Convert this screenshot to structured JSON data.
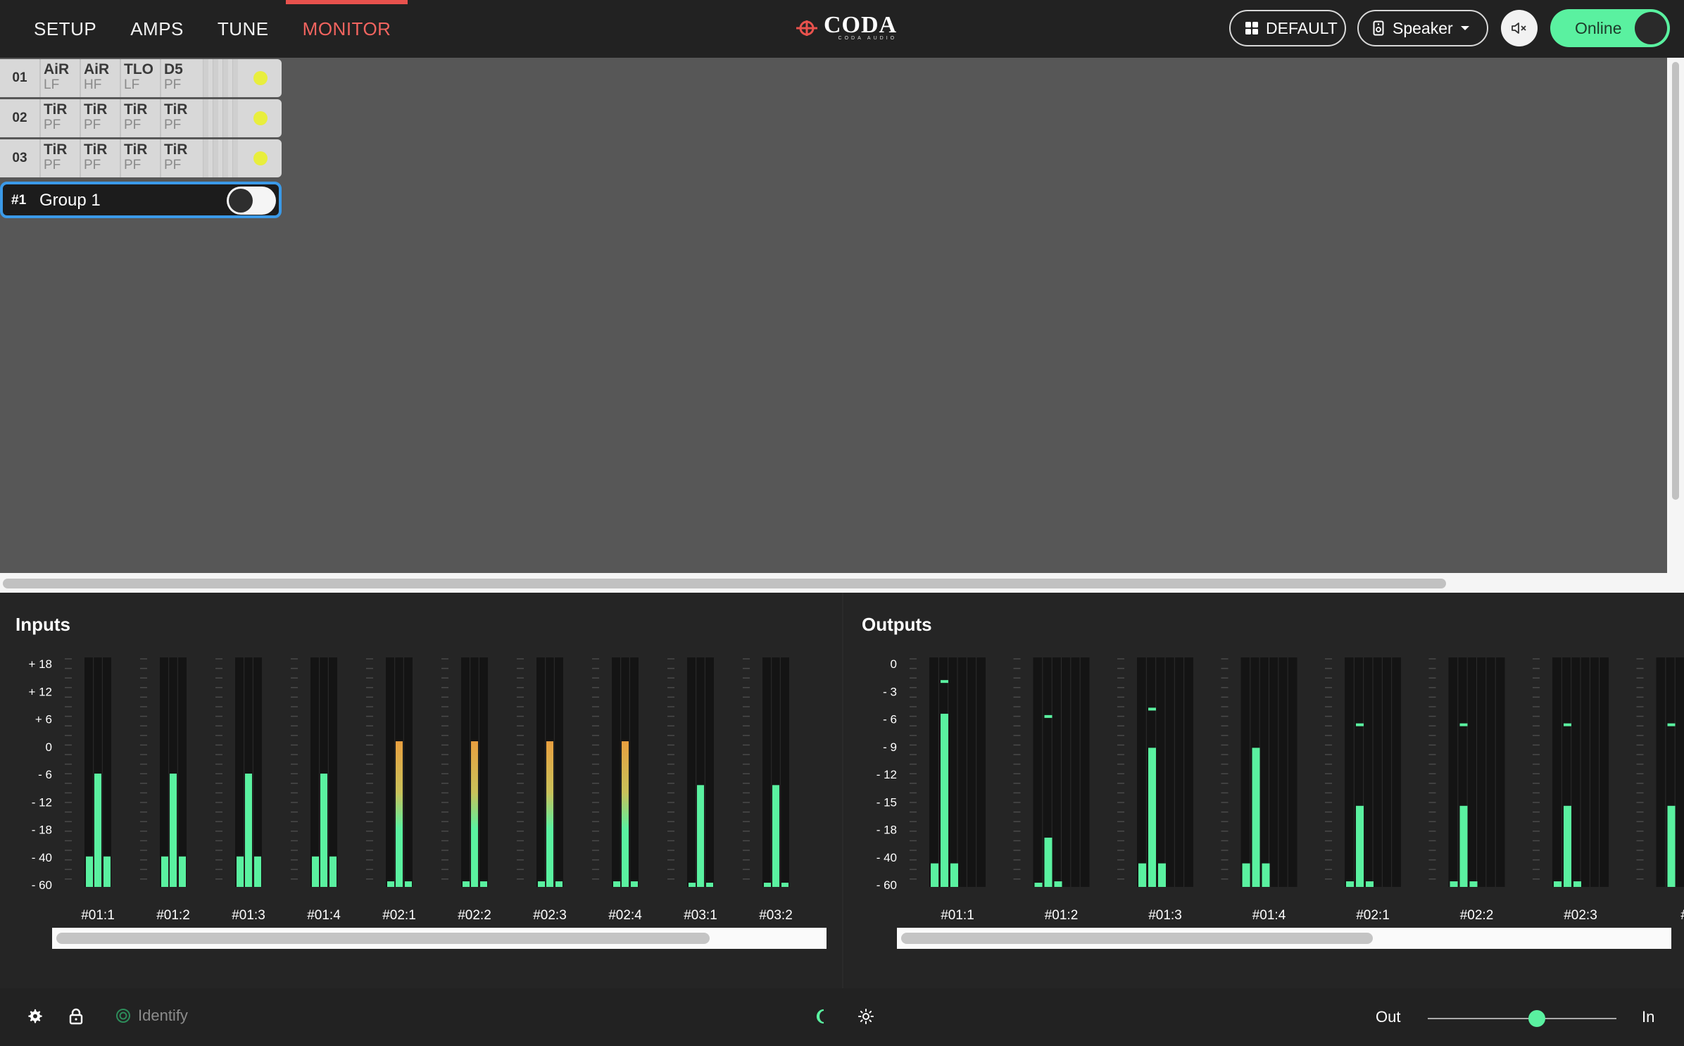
{
  "nav": {
    "tabs": [
      {
        "label": "SETUP"
      },
      {
        "label": "AMPS"
      },
      {
        "label": "TUNE"
      },
      {
        "label": "MONITOR"
      }
    ],
    "active": "MONITOR"
  },
  "logo": {
    "title": "CODA",
    "subtitle": "CODA AUDIO"
  },
  "toolbar": {
    "default_label": "DEFAULT",
    "speaker_label": "Speaker",
    "online_label": "Online"
  },
  "amps": [
    {
      "num": "01",
      "channels": [
        {
          "model": "AiR",
          "type": "LF"
        },
        {
          "model": "AiR",
          "type": "HF"
        },
        {
          "model": "TLO",
          "type": "LF"
        },
        {
          "model": "D5",
          "type": "PF"
        }
      ]
    },
    {
      "num": "02",
      "channels": [
        {
          "model": "TiR",
          "type": "PF"
        },
        {
          "model": "TiR",
          "type": "PF"
        },
        {
          "model": "TiR",
          "type": "PF"
        },
        {
          "model": "TiR",
          "type": "PF"
        }
      ]
    },
    {
      "num": "03",
      "channels": [
        {
          "model": "TiR",
          "type": "PF"
        },
        {
          "model": "TiR",
          "type": "PF"
        },
        {
          "model": "TiR",
          "type": "PF"
        },
        {
          "model": "TiR",
          "type": "PF"
        }
      ]
    }
  ],
  "group": {
    "num": "#1",
    "name": "Group 1"
  },
  "inputs": {
    "title": "Inputs",
    "scale": [
      "+ 18",
      "+ 12",
      "+ 6",
      "0",
      "- 6",
      "- 12",
      "- 18",
      "- 40",
      "- 60"
    ],
    "meters": [
      {
        "label": "#01:1",
        "level_db": -6,
        "sub_bars": [
          -40,
          -40
        ]
      },
      {
        "label": "#01:2",
        "level_db": -6,
        "sub_bars": [
          -40,
          -40
        ]
      },
      {
        "label": "#01:3",
        "level_db": -6,
        "sub_bars": [
          -40,
          -40
        ]
      },
      {
        "label": "#01:4",
        "level_db": -6,
        "sub_bars": [
          -40,
          -40
        ]
      },
      {
        "label": "#02:1",
        "level_db": 1,
        "sub_bars": [
          -58,
          -58
        ]
      },
      {
        "label": "#02:2",
        "level_db": 1,
        "sub_bars": [
          -58,
          -58
        ]
      },
      {
        "label": "#02:3",
        "level_db": 1,
        "sub_bars": [
          -58,
          -58
        ]
      },
      {
        "label": "#02:4",
        "level_db": 1,
        "sub_bars": [
          -58,
          -58
        ]
      },
      {
        "label": "#03:1",
        "level_db": -8.5,
        "sub_bars": [
          -59,
          -59
        ]
      },
      {
        "label": "#03:2",
        "level_db": -8.5,
        "sub_bars": [
          -59,
          -59
        ]
      }
    ]
  },
  "outputs": {
    "title": "Outputs",
    "scale": [
      "0",
      "- 3",
      "- 6",
      "- 9",
      "- 12",
      "- 15",
      "- 18",
      "- 40",
      "- 60"
    ],
    "meters": [
      {
        "label": "#01:1",
        "level_db": -5.5,
        "peak_db": -2,
        "sub_bars": [
          -45,
          -45
        ]
      },
      {
        "label": "#01:2",
        "level_db": -25,
        "peak_db": -5.8,
        "sub_bars": [
          -59,
          -58
        ]
      },
      {
        "label": "#01:3",
        "level_db": -9.2,
        "peak_db": -5,
        "sub_bars": [
          -45,
          -45
        ]
      },
      {
        "label": "#01:4",
        "level_db": -9.2,
        "peak_db": null,
        "sub_bars": [
          -45,
          -45
        ]
      },
      {
        "label": "#02:1",
        "level_db": -15.5,
        "peak_db": -6.7,
        "sub_bars": [
          -58,
          -58
        ]
      },
      {
        "label": "#02:2",
        "level_db": -15.5,
        "peak_db": -6.7,
        "sub_bars": [
          -58,
          -58
        ]
      },
      {
        "label": "#02:3",
        "level_db": -15.5,
        "peak_db": -6.7,
        "sub_bars": [
          -58,
          -58
        ]
      },
      {
        "label": "#",
        "level_db": -15.5,
        "peak_db": -6.7,
        "sub_bars": []
      }
    ]
  },
  "footer": {
    "identify_label": "Identify",
    "out_label": "Out",
    "in_label": "In",
    "slider_value": 0.58
  },
  "colors": {
    "accent_red": "#e8524d",
    "online_green": "#5af1a0",
    "meter_green": "#5af1a0",
    "meter_orange": "#e8a040",
    "selection_blue": "#3b9ae8",
    "led_yellow": "#e8ee3d"
  },
  "icons": {
    "default_button": "grid-icon",
    "speaker_button": "speaker-icon",
    "mute_button": "mute-icon",
    "footer_settings": "gear-icon",
    "footer_lock": "lock-icon",
    "identify": "target-icon",
    "dark_mode": "moon-icon",
    "light_mode": "sun-icon"
  }
}
